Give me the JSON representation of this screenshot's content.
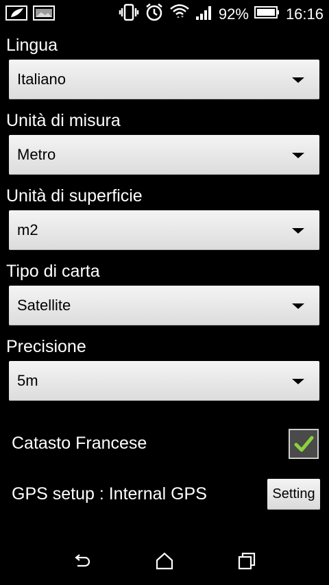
{
  "status_bar": {
    "battery_percent": "92%",
    "time": "16:16",
    "icons": [
      "leaf-notification-icon",
      "image-notification-icon",
      "vibrate-icon",
      "alarm-icon",
      "wifi-icon",
      "signal-icon",
      "battery-icon"
    ]
  },
  "settings": {
    "lingua": {
      "label": "Lingua",
      "value": "Italiano"
    },
    "unita_misura": {
      "label": "Unità di misura",
      "value": "Metro"
    },
    "unita_superficie": {
      "label": "Unità di superficie",
      "value": "m2"
    },
    "tipo_carta": {
      "label": "Tipo di carta",
      "value": "Satellite"
    },
    "precisione": {
      "label": "Precisione",
      "value": "5m"
    }
  },
  "catasto": {
    "label": "Catasto Francese",
    "checked": true
  },
  "gps": {
    "label": "GPS setup : Internal GPS",
    "button_label": "Setting"
  },
  "navigation": {
    "icons": [
      "back-icon",
      "home-icon",
      "recent-apps-icon"
    ]
  },
  "colors": {
    "check_green": "#8bd13c",
    "spinner_bg": "#e6e6e6",
    "background": "#000000"
  }
}
